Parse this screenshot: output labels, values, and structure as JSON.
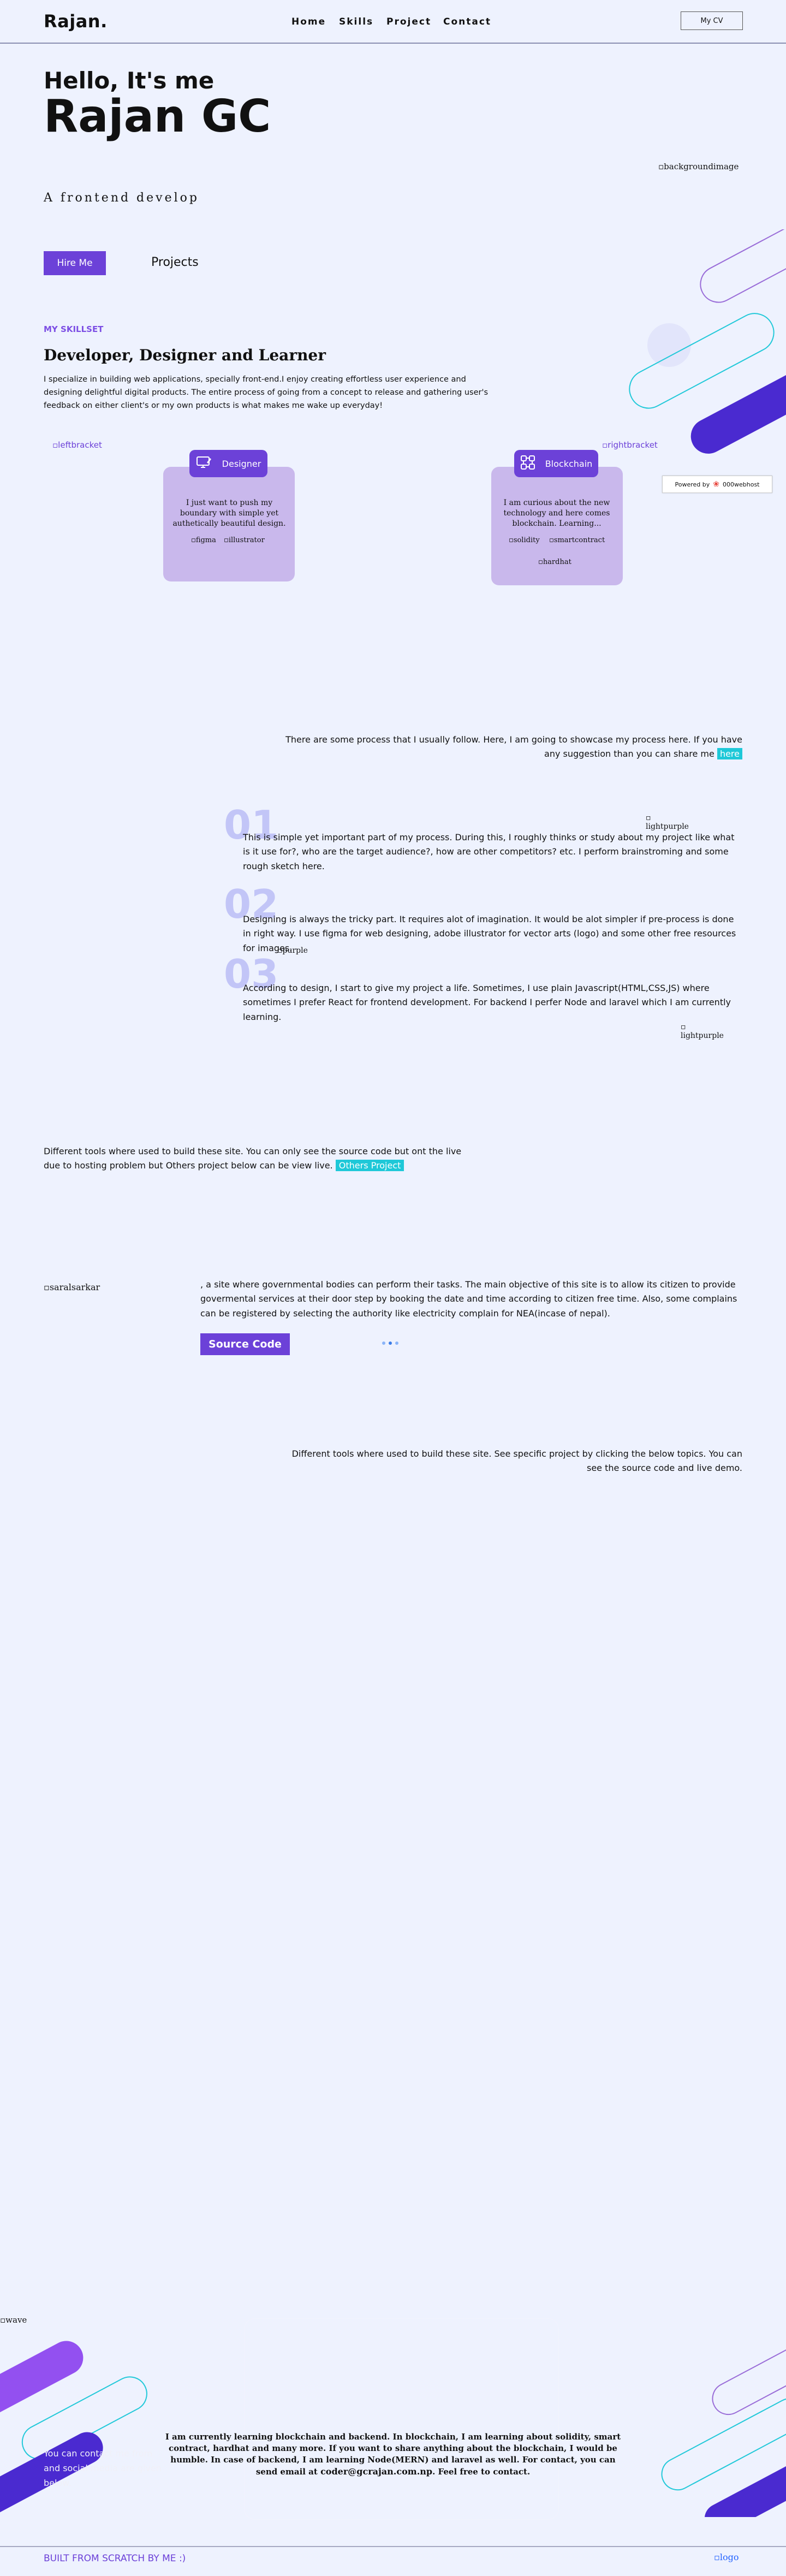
{
  "header": {
    "brand": "Rajan.",
    "nav": [
      "Home",
      "Skills",
      "Project",
      "Contact"
    ],
    "cv_label": "My CV"
  },
  "hero": {
    "greeting": "Hello, It's me",
    "name": "Rajan GC",
    "tagline": "A frontend develop",
    "background_alt": "backgroundimage",
    "hire_label": "Hire Me",
    "projects_label": "Projects"
  },
  "skills": {
    "kicker": "MY SKILLSET",
    "title": "Developer, Designer and Learner",
    "text": "I specialize in building web applications, specially front-end.I enjoy creating effortless user experience and designing delightful digital products. The entire process of going from a concept to release and gathering user's feedback on either client's or my own products is what makes me wake up everyday!",
    "left_bracket_alt": "leftbracket",
    "right_bracket_alt": "rightbracket",
    "cards": [
      {
        "title": "Designer",
        "icon": "design-tools-icon",
        "text": "I just want to push my boundary with simple yet authetically beautiful design.",
        "images": [
          "figma",
          "illustrator"
        ]
      },
      {
        "title": "Blockchain",
        "icon": "blockchain-icon",
        "text": "I am curious about the new technology and here comes blockchain. Learning...",
        "images": [
          "solidity",
          "smartcontract",
          "hardhat"
        ]
      }
    ],
    "badge": {
      "prefix": "Powered by",
      "name": "000webhost"
    }
  },
  "process": {
    "intro": "There are some process that I usually follow. Here, I am going to showcase my process here. If you have any suggestion than you can share me",
    "here_label": "here",
    "steps": [
      {
        "num": "01",
        "text": "This is simple yet important part of my process. During this, I roughly thinks or study about my project like what is it use for?, who are the target audience?, how are other competitors? etc. I perform brainstroming and some rough sketch here."
      },
      {
        "num": "02",
        "text": "Designing is always the tricky part. It requires alot of imagination. It would be alot simpler if pre-process is done in right way. I use figma for web designing, adobe illustrator for vector arts (logo) and some other free resources for images."
      },
      {
        "num": "03",
        "text": "According to design, I start to give my project a life. Sometimes, I use plain Javascript(HTML,CSS,JS) where sometimes I prefer React for frontend development. For backend I perfer Node and laravel which I am currently learning."
      }
    ],
    "img_lightpurple": "lightpurple",
    "img_purple": "purple"
  },
  "tools": {
    "text": "Different tools where used to build these site. You can only see the source code but ont the live due to hosting problem but Others project below can be view live.",
    "others_label": "Others Project",
    "project_img_alt": "saralsarkar",
    "project_text": ", a site where governmental bodies can perform their tasks. The main objective of this site is to allow its citizen to provide govermental services at their door step by booking the date and time according to citizen free time. Also, some complains can be registered by selecting the authority like electricity complain for NEA(incase of nepal).",
    "source_label": "Source Code",
    "text2": "Different tools where used to build these site. See specific project by clicking the below topics. You can see the source code and live demo."
  },
  "contact": {
    "wave_alt": "wave",
    "text_start": "I am currently learning blockchain and backend. In blockchain, I am learning about solidity, smart contract, hardhat and many more. If you want to share anything about the blockchain, I would be humble. In case of backend, I am learning Node(MERN) and laravel as well. For contact, you can send email at ",
    "email": "coder@gcrajan.com.np",
    "text_end": ". Feel free to contact.",
    "faint_text": "You can contact me from and social media are given below."
  },
  "footer": {
    "built": "BUILT FROM SCRATCH BY ME :)",
    "logo_alt": "logo"
  },
  "colors": {
    "background": "#eef2fe",
    "accent": "#6c41d8",
    "cyan": "#1ec8d8",
    "card": "#c9b8ec",
    "number": "#c2c5f7"
  }
}
